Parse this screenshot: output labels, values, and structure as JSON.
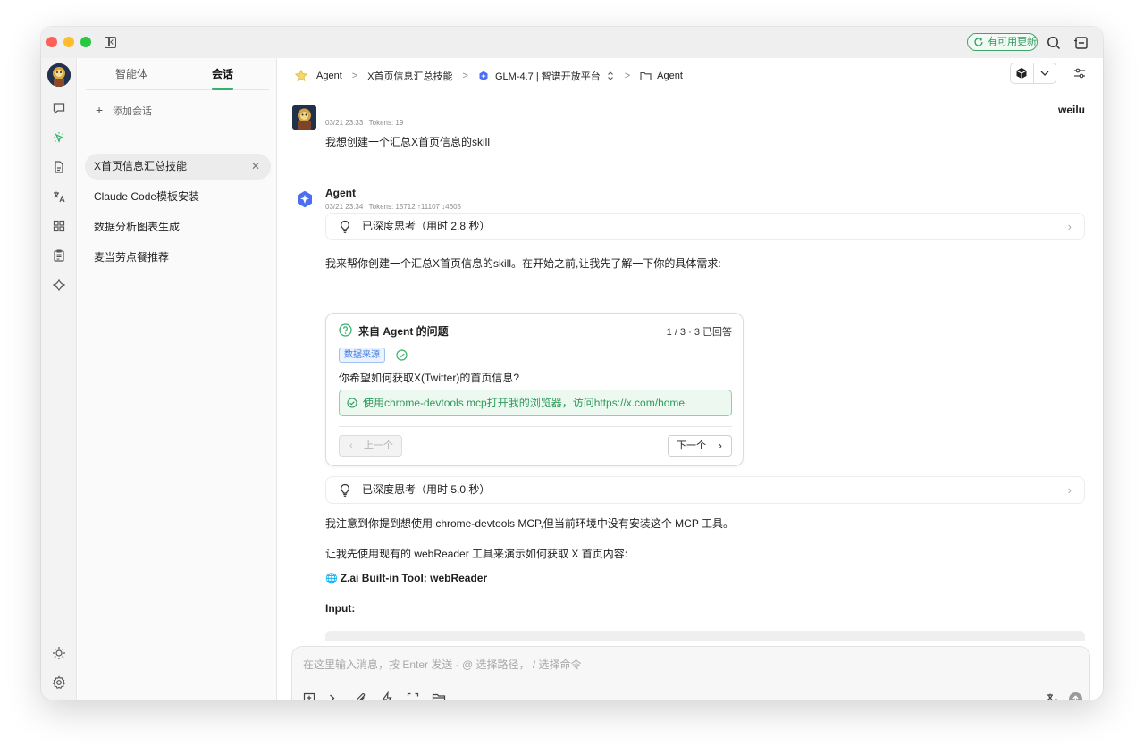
{
  "titlebar": {
    "update_label": "有可用更新"
  },
  "conv_panel": {
    "tabs": [
      {
        "label": "智能体"
      },
      {
        "label": "会话"
      }
    ],
    "add_label": "添加会话",
    "items": [
      {
        "label": "X首页信息汇总技能",
        "active": true
      },
      {
        "label": "Claude Code模板安装"
      },
      {
        "label": "数据分析图表生成"
      },
      {
        "label": "麦当劳点餐推荐"
      }
    ]
  },
  "header": {
    "breadcrumb": [
      "Agent",
      "X首页信息汇总技能",
      "GLM-4.7 | 智谱开放平台",
      "Agent"
    ]
  },
  "messages": {
    "user": {
      "name": "weilu",
      "meta": "03/21 23:33 | Tokens: 19",
      "text": "我想创建一个汇总X首页信息的skill"
    },
    "agent": {
      "name": "Agent",
      "meta": "03/21 23:34 | Tokens: 15712 ↑11107 ↓4605",
      "think1": "已深度思考（用时 2.8 秒）",
      "intro": "我来帮你创建一个汇总X首页信息的skill。在开始之前,让我先了解一下你的具体需求:",
      "question_card": {
        "title": "来自 Agent 的问题",
        "count": "1 / 3 · 3 已回答",
        "tag": "数据来源",
        "question": "你希望如何获取X(Twitter)的首页信息?",
        "answer": "使用chrome-devtools mcp打开我的浏览器，访问https://x.com/home",
        "prev_label": "上一个",
        "next_label": "下一个"
      },
      "think2": "已深度思考（用时 5.0 秒）",
      "p1": "我注意到你提到想使用 chrome-devtools MCP,但当前环境中没有安装这个 MCP 工具。",
      "p2": "让我先使用现有的 webReader 工具来演示如何获取 X 首页内容:",
      "tool_line": "Z.ai Built-in Tool: webReader",
      "input_label": "Input:"
    }
  },
  "composer": {
    "placeholder": "在这里输入消息，按 Enter 发送 - @ 选择路径， / 选择命令"
  },
  "colors": {
    "accent": "#37b26b",
    "tag_blue": "#3d7be0",
    "answer_green": "#2f9a5b"
  }
}
